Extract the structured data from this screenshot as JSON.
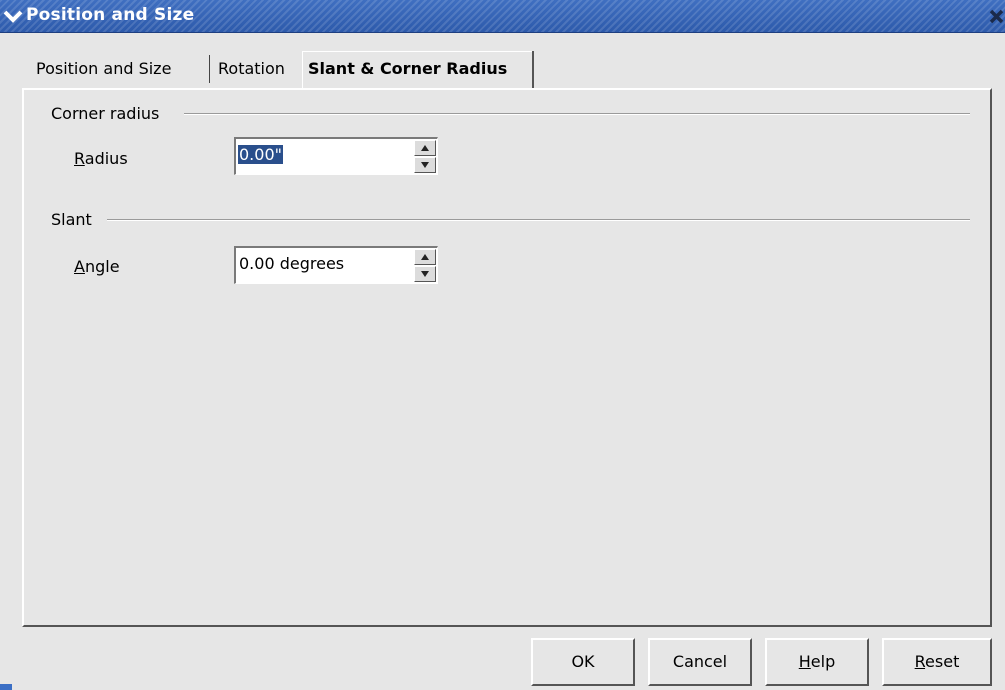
{
  "window": {
    "title": "Position and Size",
    "menu_icon": "chevron-down-icon",
    "close_icon": "close-icon"
  },
  "tabs": [
    {
      "label": "Position and Size",
      "active": false
    },
    {
      "label": "Rotation",
      "active": false
    },
    {
      "label": "Slant & Corner Radius",
      "active": true
    }
  ],
  "corner_radius": {
    "group_label": "Corner radius",
    "radius_label": "Radius",
    "radius_value": "0.00\""
  },
  "slant": {
    "group_label": "Slant",
    "angle_label": "Angle",
    "angle_value": "0.00 degrees"
  },
  "buttons": {
    "ok": "OK",
    "cancel": "Cancel",
    "help": "Help",
    "reset": "Reset"
  },
  "colors": {
    "titlebar": "#2d5aab",
    "selection": "#2a4f8c",
    "background": "#e6e6e6"
  }
}
